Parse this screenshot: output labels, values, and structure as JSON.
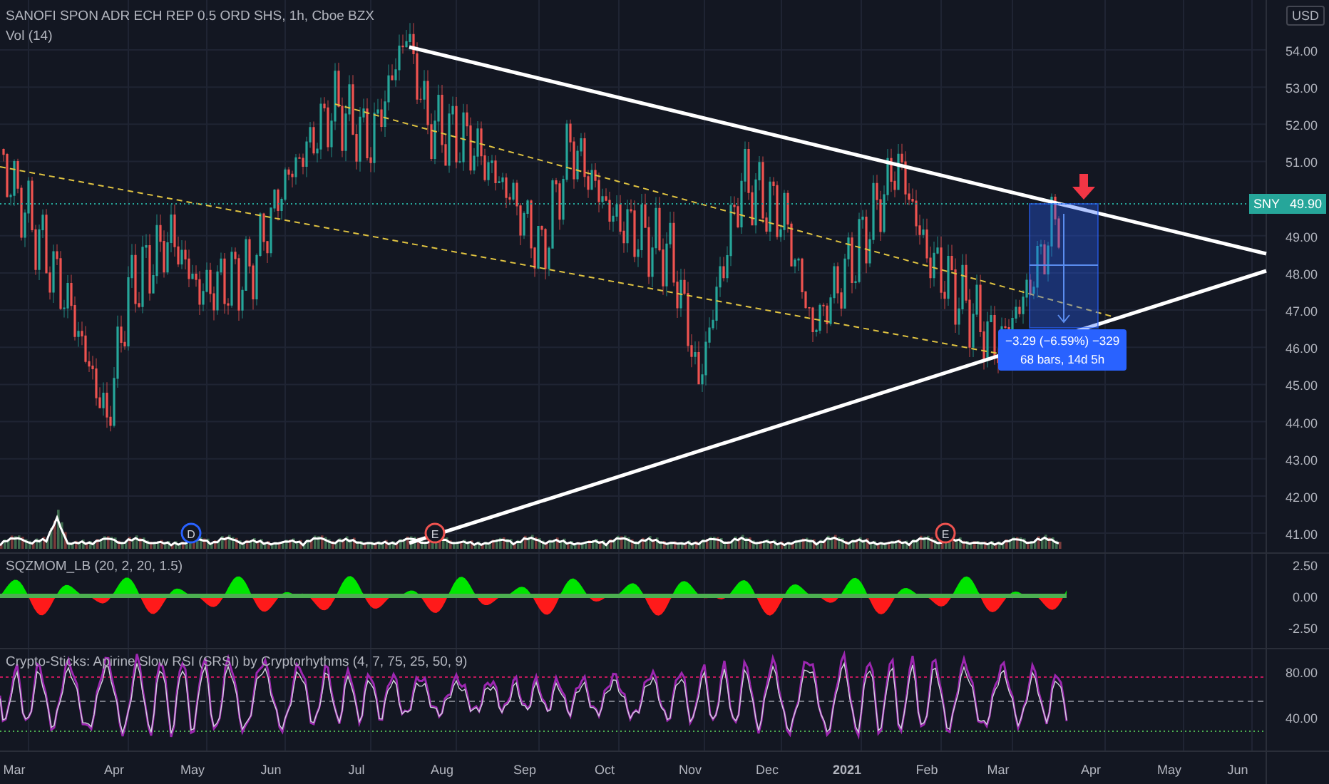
{
  "header": {
    "title": "SANOFI SPON ADR ECH REP 0.5 ORD SHS, 1h, Cboe BZX",
    "volume_label": "Vol (14)"
  },
  "price_axis": {
    "currency": "USD",
    "ticks": [
      "54.00",
      "53.00",
      "52.00",
      "51.00",
      "49.00",
      "48.00",
      "47.00",
      "46.00",
      "45.00",
      "44.00",
      "43.00",
      "42.00",
      "41.00"
    ],
    "last_price": {
      "symbol": "SNY",
      "value": "49.90"
    }
  },
  "measure": {
    "change": "−3.29 (−6.59%) −329",
    "span": "68 bars, 14d 5h"
  },
  "events": [
    {
      "letter": "D",
      "kind": "dividend"
    },
    {
      "letter": "E",
      "kind": "earnings"
    },
    {
      "letter": "E",
      "kind": "earnings"
    }
  ],
  "squeeze": {
    "label": "SQZMOM_LB (20, 2, 20, 1.5)",
    "ticks": [
      "2.50",
      "0.00",
      "-2.50"
    ]
  },
  "rsi": {
    "label": "Crypto-Sticks: Apirine Slow RSI (SRSI) by Cryptorhythms (4, 7, 75, 25, 50, 9)",
    "ticks": [
      "80.00",
      "40.00"
    ]
  },
  "time_axis": [
    "Mar",
    "Apr",
    "May",
    "Jun",
    "Jul",
    "Aug",
    "Sep",
    "Oct",
    "Nov",
    "Dec",
    "2021",
    "Feb",
    "Mar",
    "Apr",
    "May",
    "Jun"
  ]
}
